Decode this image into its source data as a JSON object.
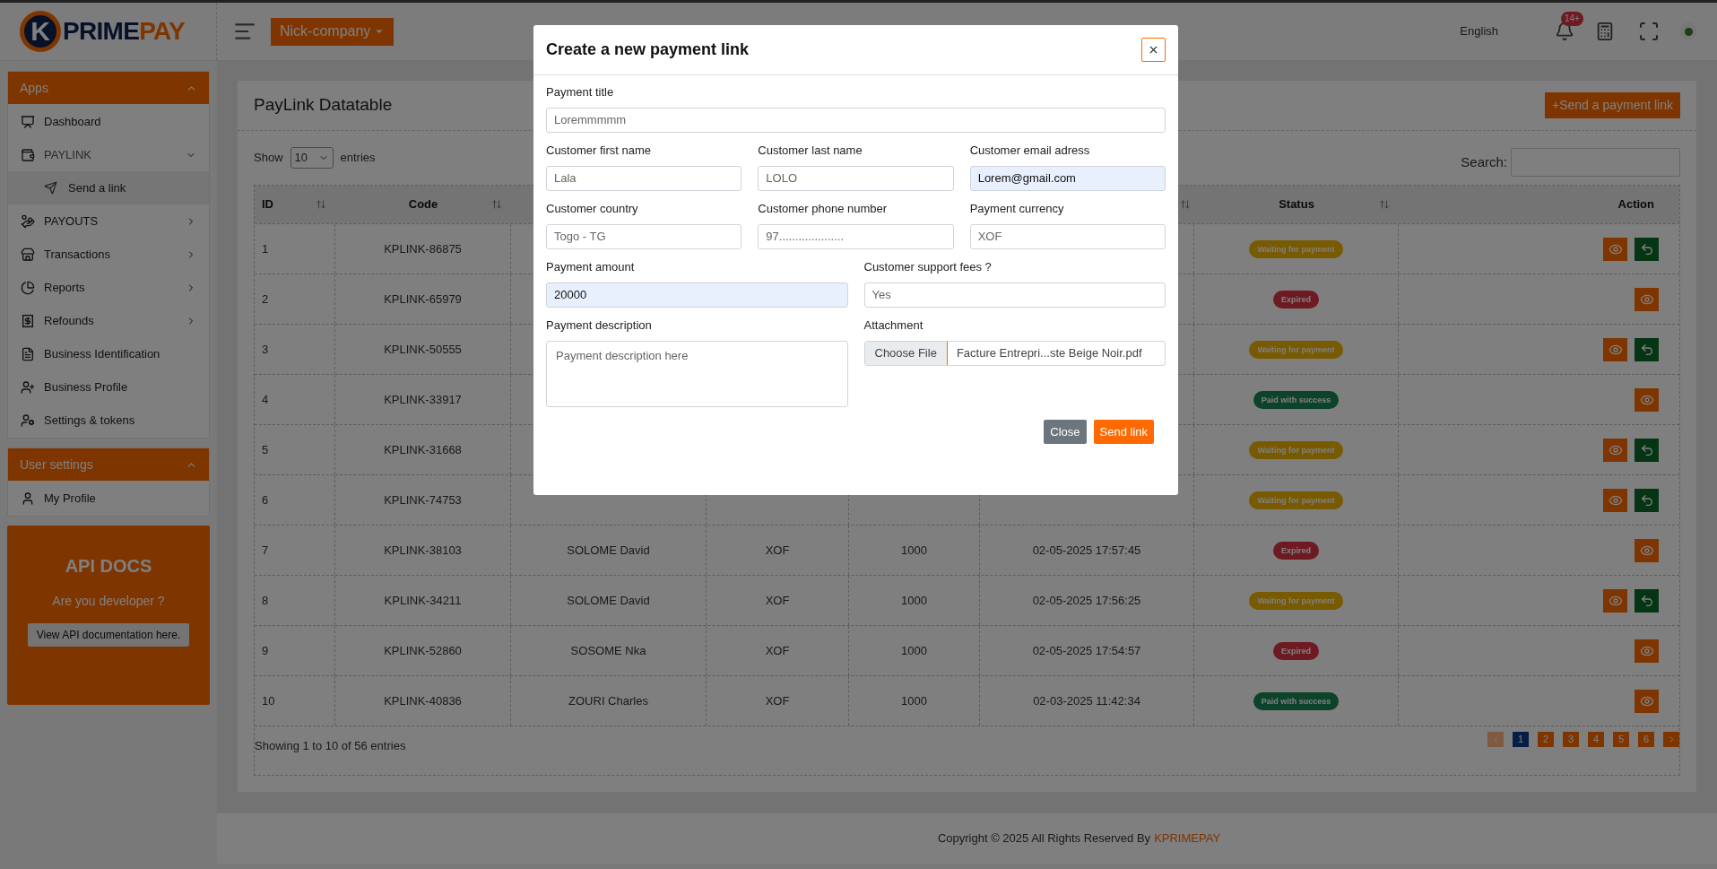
{
  "header": {
    "logo": {
      "initial": "K",
      "part_1": "PRIME",
      "part_2": "PAY"
    },
    "company": "Nick-company",
    "language": "English",
    "notification_badge": "14+"
  },
  "sidebar": {
    "sections": [
      {
        "title": "Apps",
        "expanded": true,
        "items": [
          {
            "label": "Dashboard",
            "kind": "link"
          },
          {
            "label": "PAYLINK",
            "kind": "group",
            "expanded": true,
            "children": [
              {
                "label": "Send a link",
                "selected": true
              }
            ]
          },
          {
            "label": "PAYOUTS",
            "kind": "group",
            "expanded": false
          },
          {
            "label": "Transactions",
            "kind": "group",
            "expanded": false
          },
          {
            "label": "Reports",
            "kind": "group",
            "expanded": false
          },
          {
            "label": "Refounds",
            "kind": "group",
            "expanded": false
          },
          {
            "label": "Business Identification",
            "kind": "link"
          },
          {
            "label": "Business Profile",
            "kind": "link"
          },
          {
            "label": "Settings & tokens",
            "kind": "link"
          }
        ]
      },
      {
        "title": "User settings",
        "expanded": true,
        "items": [
          {
            "label": "My Profile",
            "kind": "link"
          }
        ]
      }
    ],
    "api_docs": {
      "title": "API DOCS",
      "subtitle": "Are you developer ?",
      "button": "View API documentation here."
    }
  },
  "datatable": {
    "title": "PayLink Datatable",
    "add_button": "+Send a payment link",
    "show_label": "Show",
    "page_size": "10",
    "entries_label": "entries",
    "search_label": "Search:",
    "columns": [
      {
        "label": "ID",
        "sortable": true
      },
      {
        "label": "Code",
        "sortable": true
      },
      {},
      {},
      {},
      {
        "sortable": true
      },
      {
        "label": "Status",
        "sortable": true
      },
      {
        "label": "Action",
        "sortable": false
      }
    ],
    "rows": [
      {
        "id": "1",
        "code": "KPLINK-86875",
        "status": {
          "label": "Waiting for payment",
          "kind": "waiting"
        },
        "resendable": true
      },
      {
        "id": "2",
        "code": "KPLINK-65979",
        "status": {
          "label": "Expired",
          "kind": "expired"
        },
        "resendable": false
      },
      {
        "id": "3",
        "code": "KPLINK-50555",
        "status": {
          "label": "Waiting for payment",
          "kind": "waiting"
        },
        "resendable": true
      },
      {
        "id": "4",
        "code": "KPLINK-33917",
        "status": {
          "label": "Paid with success",
          "kind": "paid"
        },
        "resendable": false
      },
      {
        "id": "5",
        "code": "KPLINK-31668",
        "status": {
          "label": "Waiting for payment",
          "kind": "waiting"
        },
        "resendable": true
      },
      {
        "id": "6",
        "code": "KPLINK-74753",
        "status": {
          "label": "Waiting for payment",
          "kind": "waiting"
        },
        "resendable": true
      },
      {
        "id": "7",
        "code": "KPLINK-38103",
        "customer": "SOLOME David",
        "currency": "XOF",
        "amount": "1000",
        "date": "02-05-2025 17:57:45",
        "status": {
          "label": "Expired",
          "kind": "expired"
        },
        "resendable": false
      },
      {
        "id": "8",
        "code": "KPLINK-34211",
        "customer": "SOLOME David",
        "currency": "XOF",
        "amount": "1000",
        "date": "02-05-2025 17:56:25",
        "status": {
          "label": "Waiting for payment",
          "kind": "waiting"
        },
        "resendable": true
      },
      {
        "id": "9",
        "code": "KPLINK-52860",
        "customer": "SOSOME Nka",
        "currency": "XOF",
        "amount": "1000",
        "date": "02-05-2025 17:54:57",
        "status": {
          "label": "Expired",
          "kind": "expired"
        },
        "resendable": false
      },
      {
        "id": "10",
        "code": "KPLINK-40836",
        "customer": "ZOURI Charles",
        "currency": "XOF",
        "amount": "1000",
        "date": "02-03-2025 11:42:34",
        "status": {
          "label": "Paid with success",
          "kind": "paid"
        },
        "resendable": false
      }
    ],
    "summary": "Showing 1 to 10 of 56 entries",
    "pagination": {
      "previous_disabled": true,
      "next_disabled": false,
      "pages": [
        {
          "label": "1",
          "selected": true
        },
        {
          "label": "2",
          "selected": false
        },
        {
          "label": "3",
          "selected": false
        },
        {
          "label": "4",
          "selected": false
        },
        {
          "label": "5",
          "selected": false
        },
        {
          "label": "6",
          "selected": false
        }
      ]
    }
  },
  "footer": {
    "text": "Copyright © 2025 All Rights Reserved By",
    "brand": "KPRIMEPAY"
  },
  "modal": {
    "title": "Create a new payment link",
    "rows": [
      [
        {
          "label": "Payment title",
          "kind": "text",
          "value": "Loremmmmm",
          "autofilled": false
        }
      ],
      [
        {
          "label": "Customer first name",
          "kind": "text",
          "value": "Lala",
          "autofilled": false
        },
        {
          "label": "Customer last name",
          "kind": "text",
          "value": "LOLO",
          "autofilled": false
        },
        {
          "label": "Customer email adress",
          "kind": "text",
          "value": "Lorem@gmail.com",
          "autofilled": true
        }
      ],
      [
        {
          "label": "Customer country",
          "kind": "text",
          "value": "Togo - TG",
          "autofilled": false
        },
        {
          "label": "Customer phone number",
          "kind": "text",
          "value": "97....................",
          "autofilled": false
        },
        {
          "label": "Payment currency",
          "kind": "text",
          "value": "XOF",
          "autofilled": false
        }
      ],
      [
        {
          "label": "Payment amount",
          "kind": "text",
          "value": "20000",
          "autofilled": true
        },
        {
          "label": "Customer support fees ?",
          "kind": "text",
          "value": "Yes",
          "autofilled": false
        }
      ],
      [
        {
          "label": "Payment description",
          "kind": "textarea",
          "value": "Payment description here"
        },
        {
          "label": "Attachment",
          "kind": "file",
          "button": "Choose File",
          "value": "Facture Entrepri...ste Beige Noir.pdf"
        }
      ]
    ],
    "buttons": [
      {
        "label": "Close",
        "kind": "secondary"
      },
      {
        "label": "Send link",
        "kind": "primary"
      }
    ]
  }
}
